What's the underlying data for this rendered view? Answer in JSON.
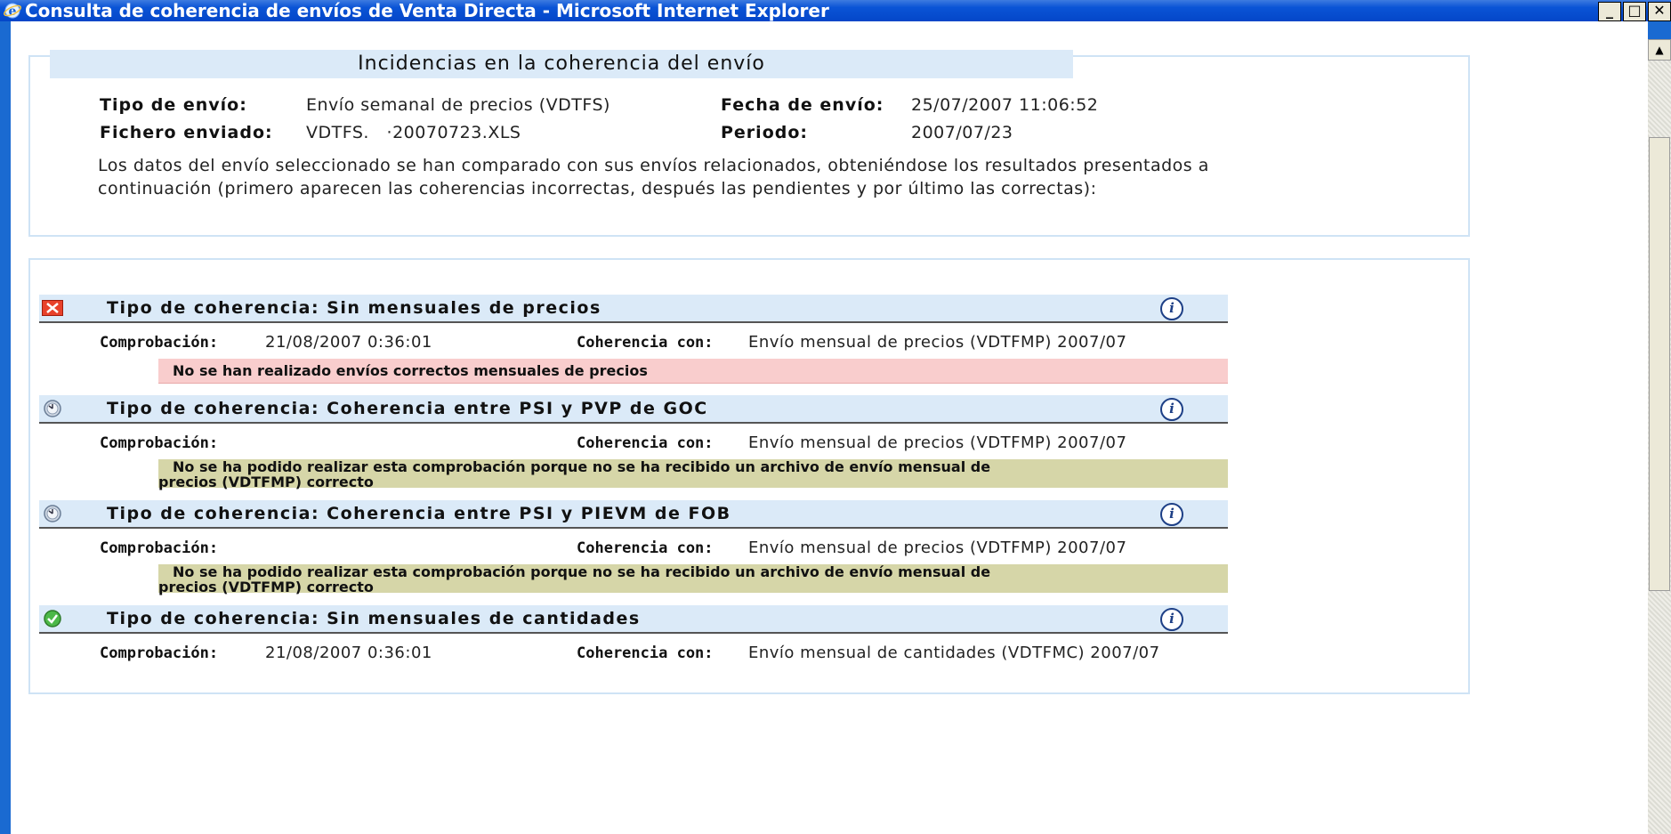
{
  "window": {
    "title": "Consulta de coherencia de envíos de Venta Directa - Microsoft Internet Explorer",
    "minimize": "_",
    "maximize": "□",
    "close": "✕"
  },
  "header": {
    "title": "Incidencias en la coherencia del envío",
    "tipo_envio_label": "Tipo de envío:",
    "tipo_envio_value": "Envío semanal de precios (VDTFS)",
    "fecha_envio_label": "Fecha de envío:",
    "fecha_envio_value": "25/07/2007 11:06:52",
    "fichero_label": "Fichero enviado:",
    "fichero_value": "VDTFS.   ·20070723.XLS",
    "periodo_label": "Periodo:",
    "periodo_value": "2007/07/23",
    "description": "Los datos del envío seleccionado se han comparado con sus envíos relacionados, obteniéndose los resultados presentados a continuación (primero aparecen las coherencias incorrectas, después las pendientes y por último las correctas):"
  },
  "coherencias": [
    {
      "status": "error",
      "icon": "error-x-icon",
      "title": "Tipo de coherencia: Sin mensuales de precios",
      "comprobacion_label": "Comprobación:",
      "comprobacion_value": "21/08/2007 0:36:01",
      "coherencia_con_label": "Coherencia con:",
      "coherencia_con_value": "Envío mensual de precios (VDTFMP) 2007/07",
      "message": "No se han realizado envíos correctos mensuales de precios"
    },
    {
      "status": "pending",
      "icon": "clock-pending-icon",
      "title": "Tipo de coherencia: Coherencia entre PSI y PVP de GOC",
      "comprobacion_label": "Comprobación:",
      "comprobacion_value": "",
      "coherencia_con_label": "Coherencia con:",
      "coherencia_con_value": "Envío mensual de precios (VDTFMP) 2007/07",
      "message_line1": "No se ha podido realizar esta comprobación porque no se ha recibido un archivo de envío mensual de",
      "message_line2": "precios (VDTFMP) correcto"
    },
    {
      "status": "pending",
      "icon": "clock-pending-icon",
      "title": "Tipo de coherencia: Coherencia entre PSI y PIEVM de FOB",
      "comprobacion_label": "Comprobación:",
      "comprobacion_value": "",
      "coherencia_con_label": "Coherencia con:",
      "coherencia_con_value": "Envío mensual de precios (VDTFMP) 2007/07",
      "message_line1": "No se ha podido realizar esta comprobación porque no se ha recibido un archivo de envío mensual de",
      "message_line2": "precios (VDTFMP) correcto"
    },
    {
      "status": "ok",
      "icon": "check-ok-icon",
      "title": "Tipo de coherencia: Sin mensuales de cantidades",
      "comprobacion_label": "Comprobación:",
      "comprobacion_value": "21/08/2007 0:36:01",
      "coherencia_con_label": "Coherencia con:",
      "coherencia_con_value": "Envío mensual de cantidades (VDTFMC) 2007/07"
    }
  ],
  "info_button_label": "i",
  "colors": {
    "error_bg": "#f9cdcd",
    "pending_bg": "#d6d6a8",
    "header_bg": "#dbeaf8",
    "titlebar": "#0a54d6"
  }
}
